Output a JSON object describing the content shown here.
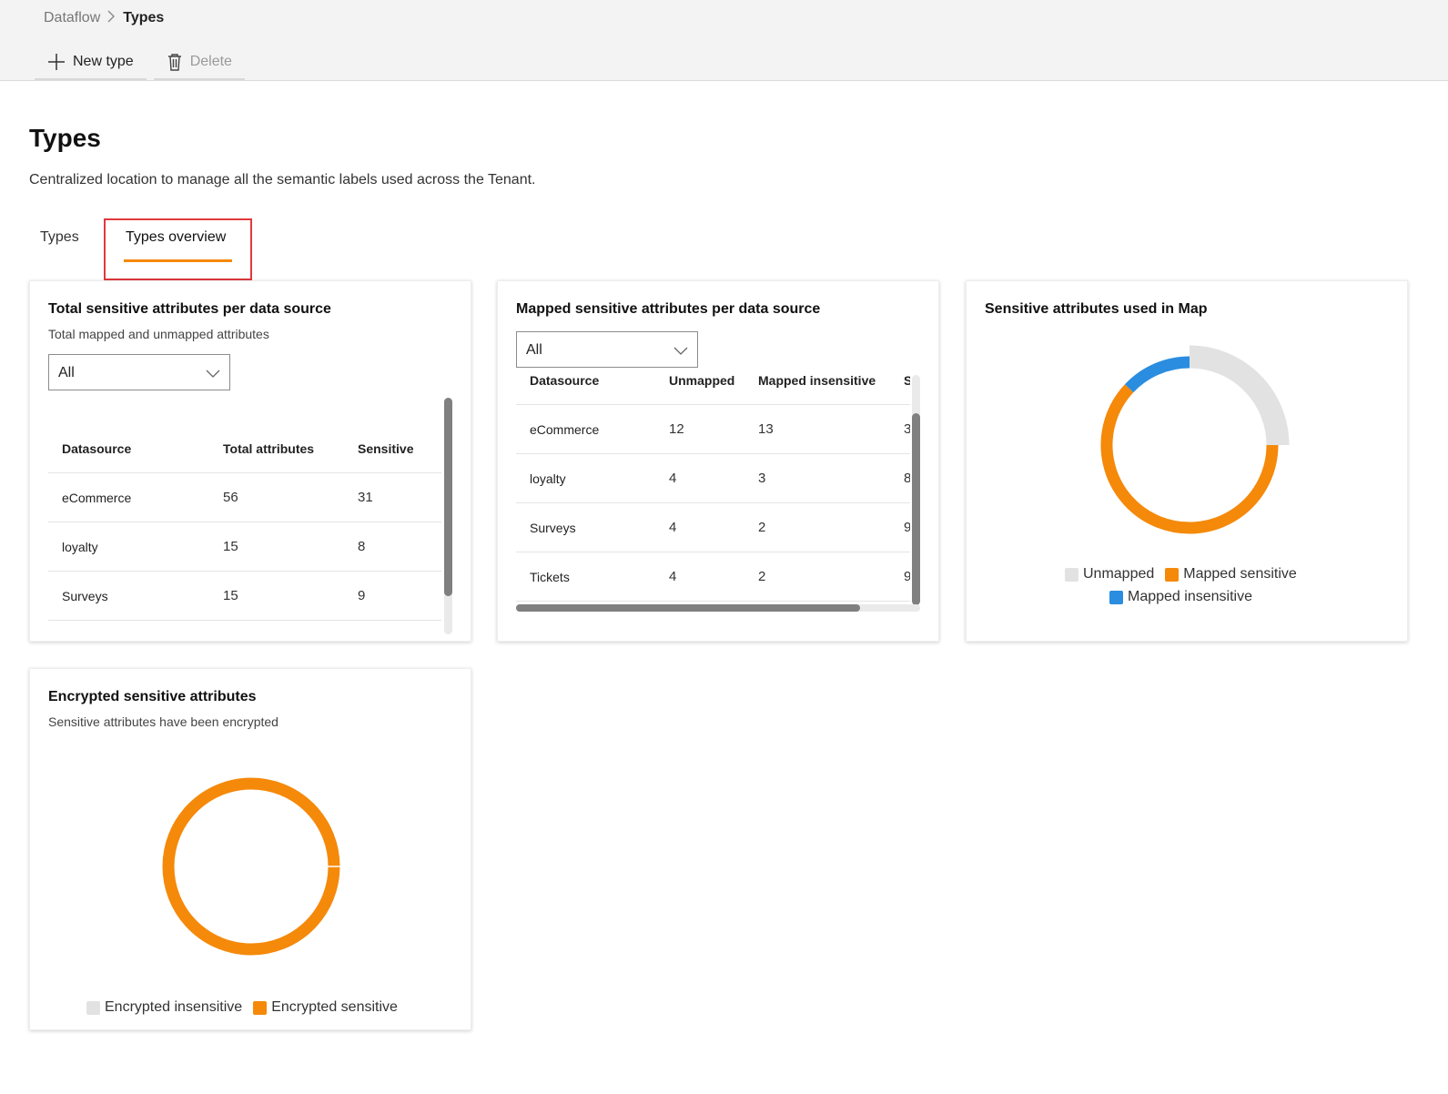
{
  "breadcrumb": {
    "root": "Dataflow",
    "current": "Types"
  },
  "toolbar": {
    "new_label": "New type",
    "delete_label": "Delete"
  },
  "page": {
    "title": "Types",
    "description": "Centralized location to manage all the semantic labels used across the Tenant."
  },
  "tabs": [
    {
      "label": "Types",
      "active": false
    },
    {
      "label": "Types overview",
      "active": true
    }
  ],
  "colors": {
    "accent": "#f5890a",
    "mapped_sensitive": "#f5890a",
    "mapped_insensitive": "#2a8de0",
    "unmapped": "#e2e2e2",
    "highlight": "#e0393e"
  },
  "card_total": {
    "title": "Total sensitive attributes per data source",
    "subtitle": "Total mapped and unmapped attributes",
    "filter": "All",
    "columns": [
      "Datasource",
      "Total attributes",
      "Sensitive"
    ],
    "rows": [
      [
        "eCommerce",
        "56",
        "31"
      ],
      [
        "loyalty",
        "15",
        "8"
      ],
      [
        "Surveys",
        "15",
        "9"
      ]
    ]
  },
  "card_mapped": {
    "title": "Mapped sensitive attributes per data source",
    "filter": "All",
    "columns": [
      "Datasource",
      "Unmapped",
      "Mapped insensitive",
      "S"
    ],
    "rows": [
      [
        "eCommerce",
        "12",
        "13",
        "3"
      ],
      [
        "loyalty",
        "4",
        "3",
        "8"
      ],
      [
        "Surveys",
        "4",
        "2",
        "9"
      ],
      [
        "Tickets",
        "4",
        "2",
        "9"
      ]
    ]
  },
  "card_map": {
    "title": "Sensitive attributes used in Map",
    "legend": [
      "Unmapped",
      "Mapped sensitive",
      "Mapped insensitive"
    ]
  },
  "card_encrypted": {
    "title": "Encrypted sensitive attributes",
    "subtitle": "Sensitive attributes have been encrypted",
    "legend": [
      "Encrypted insensitive",
      "Encrypted sensitive"
    ]
  },
  "chart_data": [
    {
      "type": "pie",
      "categories": [
        "Unmapped",
        "Mapped sensitive",
        "Mapped insensitive"
      ],
      "values": [
        25,
        62,
        13
      ],
      "title": "Sensitive attributes used in Map",
      "legend": "bottom"
    },
    {
      "type": "pie",
      "categories": [
        "Encrypted insensitive",
        "Encrypted sensitive"
      ],
      "values": [
        0,
        100
      ],
      "title": "Encrypted sensitive attributes",
      "legend": "bottom"
    }
  ]
}
